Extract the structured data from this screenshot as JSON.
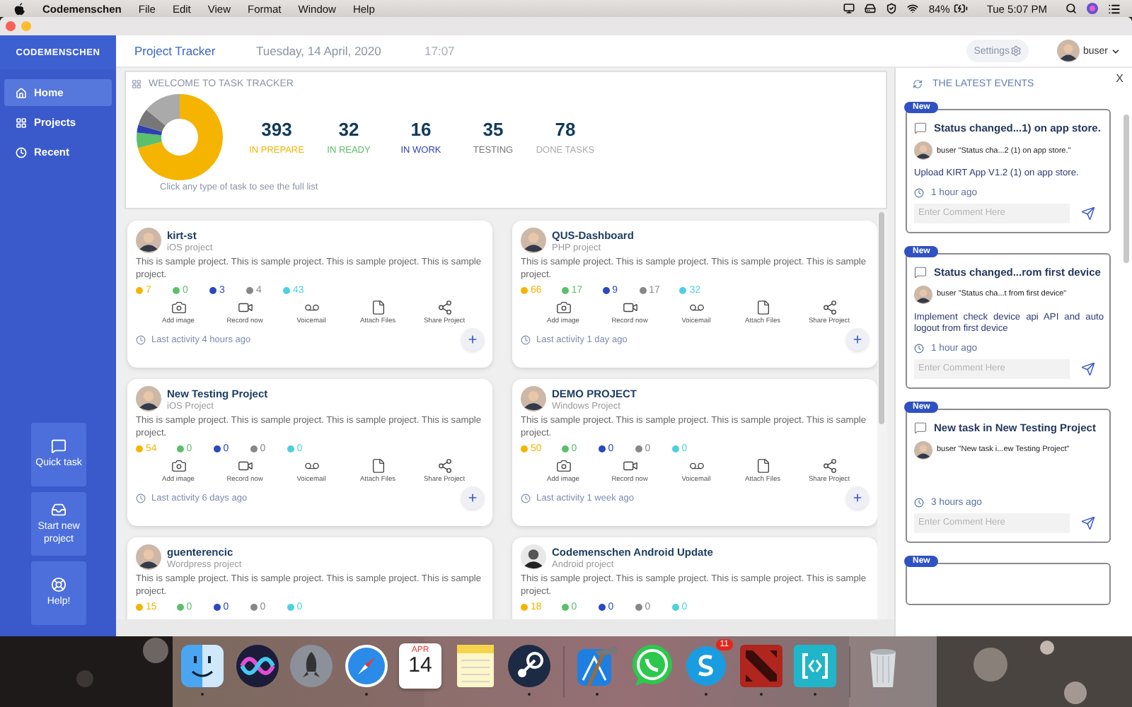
{
  "menu_bar": {
    "app": "Codemenschen",
    "menus": [
      "File",
      "Edit",
      "View",
      "Format",
      "Window",
      "Help"
    ],
    "battery": "84%",
    "clock": "Tue 5:07 PM"
  },
  "sidebar": {
    "brand": "CODEMENSCHEN",
    "items": [
      {
        "label": "Home",
        "selected": true
      },
      {
        "label": "Projects",
        "selected": false
      },
      {
        "label": "Recent",
        "selected": false
      }
    ],
    "actions": [
      {
        "label": "Quick task"
      },
      {
        "label": "Start new project"
      },
      {
        "label": "Help!"
      }
    ]
  },
  "header": {
    "title": "Project Tracker",
    "date": "Tuesday, 14 April, 2020",
    "time": "17:07",
    "settings": "Settings",
    "user": "buser"
  },
  "welcome": {
    "title": "WELCOME TO TASK TRACKER",
    "hint": "Click any type of task to see the full list",
    "stats": [
      {
        "value": "393",
        "label": "IN PREPARE",
        "color": "#f5b400"
      },
      {
        "value": "32",
        "label": "IN READY",
        "color": "#5cbf6b"
      },
      {
        "value": "16",
        "label": "IN WORK",
        "color": "#2e3fb5"
      },
      {
        "value": "35",
        "label": "TESTING",
        "color": "#777777"
      },
      {
        "value": "78",
        "label": "DONE TASKS",
        "color": "#aaaaaa"
      }
    ]
  },
  "projects": [
    {
      "name": "kirt-st",
      "type": "iOS project",
      "kind": "cartoon",
      "description": "This is sample project. This is sample project. This is sample project. This is sample project.",
      "counts": [
        {
          "value": "7",
          "color": "#f5b400"
        },
        {
          "value": "0",
          "color": "#5cbf6b"
        },
        {
          "value": "3",
          "color": "#2a48c0"
        },
        {
          "value": "4",
          "color": "#888888"
        },
        {
          "value": "43",
          "color": "#4dd0e1"
        }
      ],
      "actions": [
        {
          "label": "Add image",
          "kind": "camera"
        },
        {
          "label": "Record now",
          "kind": "video"
        },
        {
          "label": "Voicemail",
          "kind": "voicemail"
        },
        {
          "label": "Attach Files",
          "kind": "file"
        },
        {
          "label": "Share Project",
          "kind": "share"
        }
      ],
      "activity": "Last activity 4 hours ago"
    },
    {
      "name": "QUS-Dashboard",
      "type": "PHP project",
      "kind": "cartoon",
      "description": "This is sample project. This is sample project. This is sample project. This is sample project.",
      "counts": [
        {
          "value": "66",
          "color": "#f5b400"
        },
        {
          "value": "17",
          "color": "#5cbf6b"
        },
        {
          "value": "9",
          "color": "#2a48c0"
        },
        {
          "value": "17",
          "color": "#888888"
        },
        {
          "value": "32",
          "color": "#4dd0e1"
        }
      ],
      "actions": [
        {
          "label": "Add image",
          "kind": "camera"
        },
        {
          "label": "Record now",
          "kind": "video"
        },
        {
          "label": "Voicemail",
          "kind": "voicemail"
        },
        {
          "label": "Attach Files",
          "kind": "file"
        },
        {
          "label": "Share Project",
          "kind": "share"
        }
      ],
      "activity": "Last activity 1 day ago"
    },
    {
      "name": "New Testing Project",
      "type": "iOS Project",
      "kind": "cartoon",
      "description": "This is sample project. This is sample project. This is sample project. This is sample project.",
      "counts": [
        {
          "value": "54",
          "color": "#f5b400"
        },
        {
          "value": "0",
          "color": "#5cbf6b"
        },
        {
          "value": "0",
          "color": "#2a48c0"
        },
        {
          "value": "0",
          "color": "#888888"
        },
        {
          "value": "0",
          "color": "#4dd0e1"
        }
      ],
      "actions": [
        {
          "label": "Add image",
          "kind": "camera"
        },
        {
          "label": "Record now",
          "kind": "video"
        },
        {
          "label": "Voicemail",
          "kind": "voicemail"
        },
        {
          "label": "Attach Files",
          "kind": "file"
        },
        {
          "label": "Share Project",
          "kind": "share"
        }
      ],
      "activity": "Last activity 6 days ago"
    },
    {
      "name": "DEMO PROJECT",
      "type": "Windows Project",
      "kind": "cartoon",
      "description": "This is sample project. This is sample project. This is sample project. This is sample project.",
      "counts": [
        {
          "value": "50",
          "color": "#f5b400"
        },
        {
          "value": "0",
          "color": "#5cbf6b"
        },
        {
          "value": "0",
          "color": "#2a48c0"
        },
        {
          "value": "0",
          "color": "#888888"
        },
        {
          "value": "0",
          "color": "#4dd0e1"
        }
      ],
      "actions": [
        {
          "label": "Add image",
          "kind": "camera"
        },
        {
          "label": "Record now",
          "kind": "video"
        },
        {
          "label": "Voicemail",
          "kind": "voicemail"
        },
        {
          "label": "Attach Files",
          "kind": "file"
        },
        {
          "label": "Share Project",
          "kind": "share"
        }
      ],
      "activity": "Last activity 1 week ago"
    },
    {
      "name": "guenterencic",
      "type": "Wordpress project",
      "kind": "cartoon",
      "description": "This is sample project. This is sample project. This is sample project. This is sample project.",
      "counts": [
        {
          "value": "15",
          "color": "#f5b400"
        },
        {
          "value": "0",
          "color": "#5cbf6b"
        },
        {
          "value": "0",
          "color": "#2a48c0"
        },
        {
          "value": "0",
          "color": "#888888"
        },
        {
          "value": "0",
          "color": "#4dd0e1"
        }
      ]
    },
    {
      "name": "Codemenschen Android Update",
      "type": "Android project",
      "description": "This is sample project. This is sample project. This is sample project. This is sample project.",
      "counts": [
        {
          "value": "18",
          "color": "#f5b400"
        },
        {
          "value": "0",
          "color": "#5cbf6b"
        },
        {
          "value": "0",
          "color": "#2a48c0"
        },
        {
          "value": "0",
          "color": "#888888"
        },
        {
          "value": "0",
          "color": "#4dd0e1"
        }
      ]
    }
  ],
  "events": {
    "title": "THE LATEST EVENTS",
    "close": "X",
    "items": [
      {
        "badge": "New",
        "title": "Status changed...1) on app store.",
        "user": "buser \"Status cha...2 (1) on app store.\"",
        "body": "Upload KIRT App V1.2 (1) on app store.",
        "time": "1 hour ago",
        "placeholder": "Enter Comment Here"
      },
      {
        "badge": "New",
        "title": "Status changed...rom first device",
        "user": "buser \"Status cha...t from first device\"",
        "body": "Implement check device api API and auto logout from first device",
        "time": "1 hour ago",
        "placeholder": "Enter Comment Here"
      },
      {
        "badge": "New",
        "title": "New task in New Testing Project",
        "user": "buser \"New task i...ew Testing Project\"",
        "time": "3 hours ago",
        "placeholder": "Enter Comment Here"
      },
      {
        "badge": "New"
      }
    ]
  },
  "dock": [
    {
      "kind": "finder",
      "running": true
    },
    {
      "kind": "siri",
      "running": false
    },
    {
      "kind": "launchpad",
      "running": false
    },
    {
      "kind": "safari",
      "running": true
    },
    {
      "kind": "calendar",
      "month": "APR",
      "day": "14",
      "running": false
    },
    {
      "kind": "notes",
      "running": false
    },
    {
      "kind": "steam",
      "running": true
    },
    {
      "kind": "separator"
    },
    {
      "kind": "xcode",
      "running": true
    },
    {
      "kind": "whatsapp",
      "running": false
    },
    {
      "kind": "skype",
      "badge": "11",
      "running": true
    },
    {
      "kind": "dota",
      "running": true
    },
    {
      "kind": "brackets",
      "running": true
    },
    {
      "kind": "separator"
    },
    {
      "kind": "trash",
      "running": false
    }
  ]
}
